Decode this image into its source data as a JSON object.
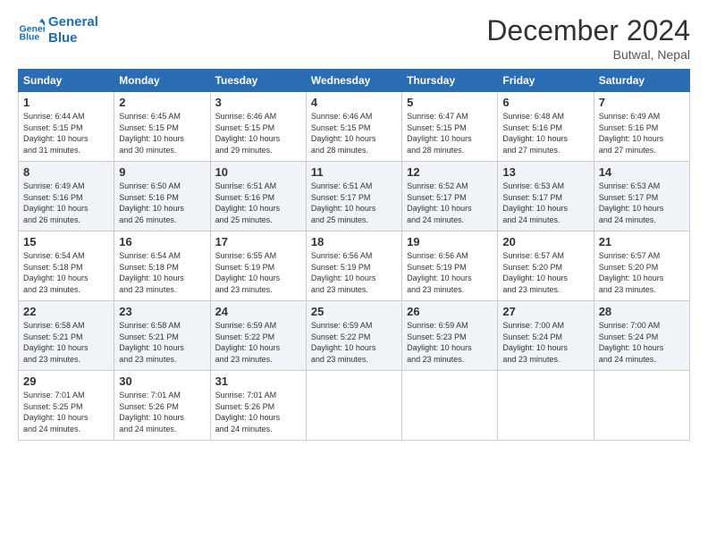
{
  "logo": {
    "line1": "General",
    "line2": "Blue"
  },
  "title": "December 2024",
  "location": "Butwal, Nepal",
  "weekdays": [
    "Sunday",
    "Monday",
    "Tuesday",
    "Wednesday",
    "Thursday",
    "Friday",
    "Saturday"
  ],
  "weeks": [
    [
      {
        "day": 1,
        "info": "Sunrise: 6:44 AM\nSunset: 5:15 PM\nDaylight: 10 hours\nand 31 minutes."
      },
      {
        "day": 2,
        "info": "Sunrise: 6:45 AM\nSunset: 5:15 PM\nDaylight: 10 hours\nand 30 minutes."
      },
      {
        "day": 3,
        "info": "Sunrise: 6:46 AM\nSunset: 5:15 PM\nDaylight: 10 hours\nand 29 minutes."
      },
      {
        "day": 4,
        "info": "Sunrise: 6:46 AM\nSunset: 5:15 PM\nDaylight: 10 hours\nand 28 minutes."
      },
      {
        "day": 5,
        "info": "Sunrise: 6:47 AM\nSunset: 5:15 PM\nDaylight: 10 hours\nand 28 minutes."
      },
      {
        "day": 6,
        "info": "Sunrise: 6:48 AM\nSunset: 5:16 PM\nDaylight: 10 hours\nand 27 minutes."
      },
      {
        "day": 7,
        "info": "Sunrise: 6:49 AM\nSunset: 5:16 PM\nDaylight: 10 hours\nand 27 minutes."
      }
    ],
    [
      {
        "day": 8,
        "info": "Sunrise: 6:49 AM\nSunset: 5:16 PM\nDaylight: 10 hours\nand 26 minutes."
      },
      {
        "day": 9,
        "info": "Sunrise: 6:50 AM\nSunset: 5:16 PM\nDaylight: 10 hours\nand 26 minutes."
      },
      {
        "day": 10,
        "info": "Sunrise: 6:51 AM\nSunset: 5:16 PM\nDaylight: 10 hours\nand 25 minutes."
      },
      {
        "day": 11,
        "info": "Sunrise: 6:51 AM\nSunset: 5:17 PM\nDaylight: 10 hours\nand 25 minutes."
      },
      {
        "day": 12,
        "info": "Sunrise: 6:52 AM\nSunset: 5:17 PM\nDaylight: 10 hours\nand 24 minutes."
      },
      {
        "day": 13,
        "info": "Sunrise: 6:53 AM\nSunset: 5:17 PM\nDaylight: 10 hours\nand 24 minutes."
      },
      {
        "day": 14,
        "info": "Sunrise: 6:53 AM\nSunset: 5:17 PM\nDaylight: 10 hours\nand 24 minutes."
      }
    ],
    [
      {
        "day": 15,
        "info": "Sunrise: 6:54 AM\nSunset: 5:18 PM\nDaylight: 10 hours\nand 23 minutes."
      },
      {
        "day": 16,
        "info": "Sunrise: 6:54 AM\nSunset: 5:18 PM\nDaylight: 10 hours\nand 23 minutes."
      },
      {
        "day": 17,
        "info": "Sunrise: 6:55 AM\nSunset: 5:19 PM\nDaylight: 10 hours\nand 23 minutes."
      },
      {
        "day": 18,
        "info": "Sunrise: 6:56 AM\nSunset: 5:19 PM\nDaylight: 10 hours\nand 23 minutes."
      },
      {
        "day": 19,
        "info": "Sunrise: 6:56 AM\nSunset: 5:19 PM\nDaylight: 10 hours\nand 23 minutes."
      },
      {
        "day": 20,
        "info": "Sunrise: 6:57 AM\nSunset: 5:20 PM\nDaylight: 10 hours\nand 23 minutes."
      },
      {
        "day": 21,
        "info": "Sunrise: 6:57 AM\nSunset: 5:20 PM\nDaylight: 10 hours\nand 23 minutes."
      }
    ],
    [
      {
        "day": 22,
        "info": "Sunrise: 6:58 AM\nSunset: 5:21 PM\nDaylight: 10 hours\nand 23 minutes."
      },
      {
        "day": 23,
        "info": "Sunrise: 6:58 AM\nSunset: 5:21 PM\nDaylight: 10 hours\nand 23 minutes."
      },
      {
        "day": 24,
        "info": "Sunrise: 6:59 AM\nSunset: 5:22 PM\nDaylight: 10 hours\nand 23 minutes."
      },
      {
        "day": 25,
        "info": "Sunrise: 6:59 AM\nSunset: 5:22 PM\nDaylight: 10 hours\nand 23 minutes."
      },
      {
        "day": 26,
        "info": "Sunrise: 6:59 AM\nSunset: 5:23 PM\nDaylight: 10 hours\nand 23 minutes."
      },
      {
        "day": 27,
        "info": "Sunrise: 7:00 AM\nSunset: 5:24 PM\nDaylight: 10 hours\nand 23 minutes."
      },
      {
        "day": 28,
        "info": "Sunrise: 7:00 AM\nSunset: 5:24 PM\nDaylight: 10 hours\nand 24 minutes."
      }
    ],
    [
      {
        "day": 29,
        "info": "Sunrise: 7:01 AM\nSunset: 5:25 PM\nDaylight: 10 hours\nand 24 minutes."
      },
      {
        "day": 30,
        "info": "Sunrise: 7:01 AM\nSunset: 5:26 PM\nDaylight: 10 hours\nand 24 minutes."
      },
      {
        "day": 31,
        "info": "Sunrise: 7:01 AM\nSunset: 5:26 PM\nDaylight: 10 hours\nand 24 minutes."
      },
      null,
      null,
      null,
      null
    ]
  ]
}
